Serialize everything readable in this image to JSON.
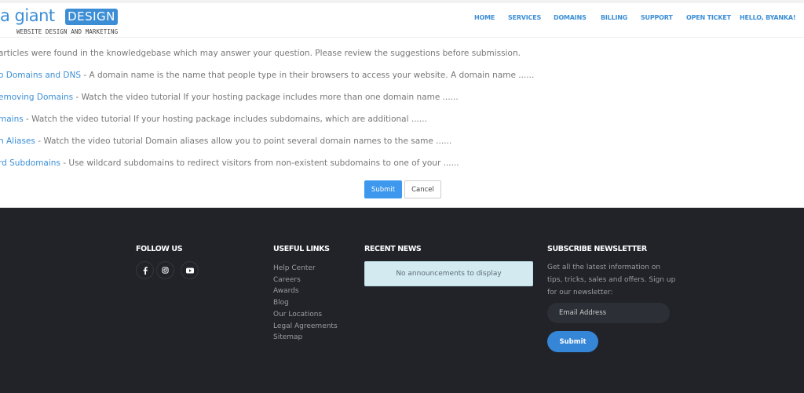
{
  "header": {
    "logo": {
      "main_text": "a giant",
      "badge_text": "DESIGN",
      "tagline": "WEBSITE DESIGN AND MARKETING"
    },
    "nav": [
      {
        "label": "HOME"
      },
      {
        "label": "SERVICES"
      },
      {
        "label": "DOMAINS"
      },
      {
        "label": "BILLING"
      },
      {
        "label": "SUPPORT"
      },
      {
        "label": "OPEN TICKET"
      },
      {
        "label": "HELLO, BYANKA!"
      }
    ]
  },
  "content": {
    "intro": "articles were found in the knowledgebase which may answer your question. Please review the suggestions before submission.",
    "articles": [
      {
        "title": "o Domains and DNS",
        "summary": " - A domain name is the name that people type in their browsers to access your website. A domain name ......"
      },
      {
        "title": "emoving Domains",
        "summary": " - Watch the video tutorial If your hosting package includes more than one domain name ......"
      },
      {
        "title": "mains",
        "summary": " - Watch the video tutorial If your hosting package includes subdomains, which are additional ......"
      },
      {
        "title": "n Aliases",
        "summary": " - Watch the video tutorial Domain aliases allow you to point several domain names to the same ......"
      },
      {
        "title": "rd Subdomains",
        "summary": " - Use wildcard subdomains to redirect visitors from non-existent subdomains to one of your ......"
      }
    ],
    "submit_label": "Submit",
    "cancel_label": "Cancel"
  },
  "footer": {
    "follow": {
      "heading": "FOLLOW US",
      "icons": [
        "facebook-icon",
        "instagram-icon",
        "youtube-icon"
      ]
    },
    "useful_links": {
      "heading": "USEFUL LINKS",
      "items": [
        "Help Center",
        "Careers",
        "Awards",
        "Blog",
        "Our Locations",
        "Legal Agreements",
        "Sitemap"
      ]
    },
    "recent_news": {
      "heading": "RECENT NEWS",
      "empty_message": "No announcements to display"
    },
    "newsletter": {
      "heading": "SUBSCRIBE NEWSLETTER",
      "description": "Get all the latest information on tips, tricks, sales and offers. Sign up for our newsletter:",
      "email_placeholder": "Email Address",
      "submit_label": "Submit"
    }
  },
  "colors": {
    "accent": "#3b8ed6",
    "submit_button": "#3d98ee",
    "footer_bg": "#212328",
    "news_box_bg": "#d4eaf1"
  }
}
